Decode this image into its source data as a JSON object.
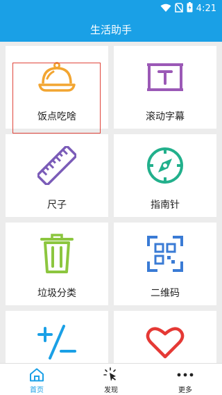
{
  "status_bar": {
    "time": "4:21",
    "icons": [
      "wifi-icon",
      "no-sim-icon",
      "battery-charging-icon"
    ]
  },
  "app_bar": {
    "title": "生活助手"
  },
  "tiles": [
    {
      "label": "饭点吃啥",
      "icon": "food-cloche-icon",
      "color": "#f2a531",
      "selected": true
    },
    {
      "label": "滚动字幕",
      "icon": "scrolling-text-icon",
      "color": "#9b59b6"
    },
    {
      "label": "尺子",
      "icon": "ruler-icon",
      "color": "#7b5cb8"
    },
    {
      "label": "指南针",
      "icon": "compass-icon",
      "color": "#22b08c"
    },
    {
      "label": "垃圾分类",
      "icon": "trash-can-icon",
      "color": "#8cc63f"
    },
    {
      "label": "二维码",
      "icon": "qr-code-icon",
      "color": "#3a7bd5"
    },
    {
      "label": "",
      "icon": "calculator-plus-minus-icon",
      "color": "#1aa0e6"
    },
    {
      "label": "",
      "icon": "heart-icon",
      "color": "#e53935"
    }
  ],
  "bottom_nav": [
    {
      "label": "首页",
      "icon": "home-icon",
      "active": true
    },
    {
      "label": "发现",
      "icon": "discover-sparkle-icon",
      "active": false
    },
    {
      "label": "更多",
      "icon": "more-dots-icon",
      "active": false
    }
  ],
  "colors": {
    "primary": "#1aa0e6",
    "selection_border": "#e0443a",
    "background": "#ececec"
  }
}
